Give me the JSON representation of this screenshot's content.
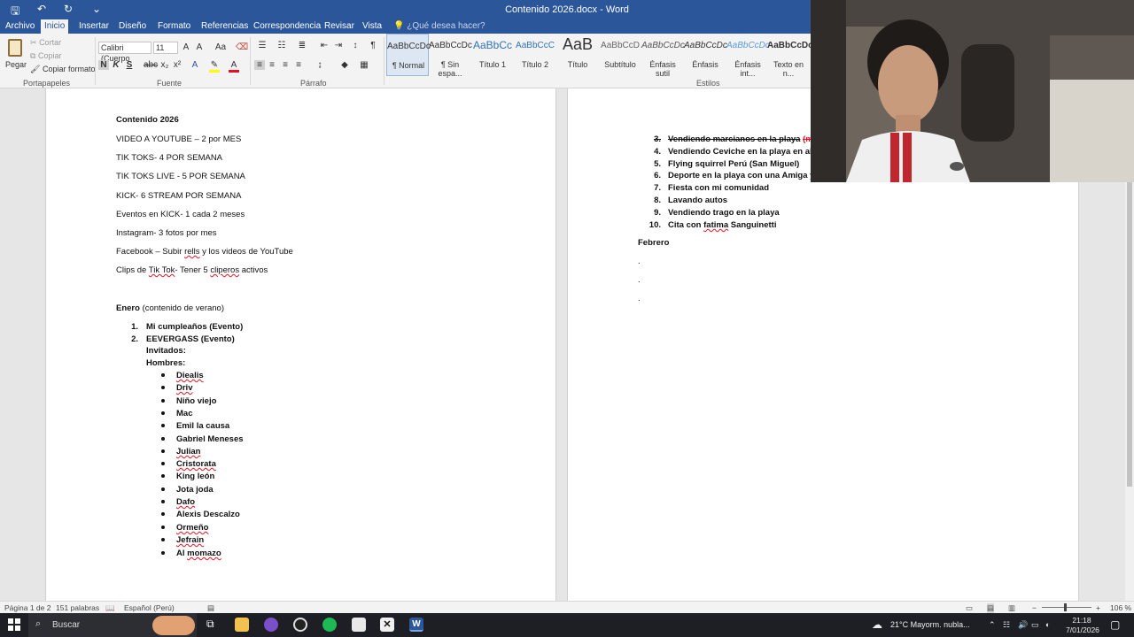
{
  "titlebar": {
    "title": "Contenido 2026.docx - Word",
    "qa_save": "🖫",
    "qa_undo": "↶",
    "qa_redo": "↻",
    "qa_more": "⌄"
  },
  "tabs": [
    "Archivo",
    "Inicio",
    "Insertar",
    "Diseño",
    "Formato",
    "Referencias",
    "Correspondencia",
    "Revisar",
    "Vista"
  ],
  "tellme": "¿Qué desea hacer?",
  "ribbon": {
    "clipboard": {
      "paste": "Pegar",
      "cut": "Cortar",
      "copy": "Copiar",
      "format_painter": "Copiar formato",
      "label": "Portapapeles"
    },
    "font": {
      "name": "Calibri (Cuerpo",
      "size": "11",
      "label": "Fuente",
      "bold": "N",
      "italic": "K",
      "underline": "S"
    },
    "paragraph": {
      "label": "Párrafo"
    },
    "styles": {
      "label": "Estilos",
      "items": [
        {
          "preview": "AaBbCcDc",
          "name": "¶ Normal"
        },
        {
          "preview": "AaBbCcDc",
          "name": "¶ Sin espa..."
        },
        {
          "preview": "AaBbCc",
          "name": "Título 1"
        },
        {
          "preview": "AaBbCcC",
          "name": "Título 2"
        },
        {
          "preview": "AaB",
          "name": "Título"
        },
        {
          "preview": "AaBbCcD",
          "name": "Subtítulo"
        },
        {
          "preview": "AaBbCcDc",
          "name": "Énfasis sutil"
        },
        {
          "preview": "AaBbCcDc",
          "name": "Énfasis"
        },
        {
          "preview": "AaBbCcDc",
          "name": "Énfasis int..."
        },
        {
          "preview": "AaBbCcDc",
          "name": "Texto en n..."
        }
      ]
    }
  },
  "page1": {
    "heading": "Contenido 2026",
    "lines": [
      "VIDEO A YOUTUBE – 2 por MES",
      "TIK TOKS- 4 POR SEMANA",
      "TIK TOKS LIVE - 5 POR SEMANA",
      "KICK- 6 STREAM POR SEMANA",
      "Eventos en KICK-  1 cada 2 meses",
      "Instagram- 3 fotos por mes"
    ],
    "facebook": {
      "a": "Facebook – Subir ",
      "b": "rells",
      "c": " y los videos de YouTube"
    },
    "clips": {
      "a": "Clips de ",
      "b": "Tik Tok",
      "c": "- Tener 5 ",
      "d": "cliperos",
      "e": " activos"
    },
    "enero": {
      "bold": "Enero",
      "rest": " (contenido de verano)"
    },
    "numbered": [
      {
        "n": "1.",
        "text": "Mi cumpleaños (Evento)"
      },
      {
        "n": "2.",
        "text": "EEVERGASS (Evento)"
      }
    ],
    "invitados": "Invitados:",
    "hombres": "Hombres:",
    "guests": [
      {
        "name": "Diealis",
        "sq": true
      },
      {
        "name": "Driv",
        "sq": true
      },
      {
        "name": "Niño viejo",
        "sq": false
      },
      {
        "name": "Mac",
        "sq": false
      },
      {
        "name": "Emil la causa",
        "sq": false
      },
      {
        "name": "Gabriel Meneses",
        "sq": false
      },
      {
        "name": "Julian",
        "sq": true
      },
      {
        "name": "Cristorata",
        "sq": true
      },
      {
        "name": "King león",
        "sq": false
      },
      {
        "name": "Jota joda",
        "sq": false
      },
      {
        "name": "Dafo",
        "sq": true
      },
      {
        "name": "Alexis Descalzo",
        "sq": false
      },
      {
        "name": "Ormeño",
        "sq": true
      },
      {
        "name": "Jefrain",
        "sq": true
      },
      {
        "name_a": "Al ",
        "name_b": "momazo",
        "sq": true
      }
    ]
  },
  "page2": {
    "items": [
      {
        "n": "3.",
        "text": "Vendiendo marcianos en la playa",
        "extra": "(ma",
        "strike": true
      },
      {
        "n": "4.",
        "text": "Vendiendo Ceviche en la playa en alta"
      },
      {
        "n": "5.",
        "text": "Flying squirrel Perú (San Miguel)"
      },
      {
        "n": "6.",
        "text": "Deporte en la playa con una Amiga y"
      },
      {
        "n": "7.",
        "text": "Fiesta con mi comunidad"
      },
      {
        "n": "8.",
        "text": "Lavando autos"
      },
      {
        "n": "9.",
        "text": "Vendiendo trago en la playa"
      },
      {
        "n": "10.",
        "text_a": "Cita con ",
        "text_b": "fatima",
        "text_c": " Sanguinetti"
      }
    ],
    "febrero": "Febrero",
    "dots": [
      ".",
      ".",
      "."
    ]
  },
  "status": {
    "page": "Página 1 de 2",
    "words": "151 palabras",
    "lang": "Español (Perú)",
    "zoom": "106 %"
  },
  "taskbar": {
    "search": "Buscar",
    "weather": "21°C  Mayorm. nubla...",
    "time": "21:18",
    "date": "7/01/2026"
  }
}
